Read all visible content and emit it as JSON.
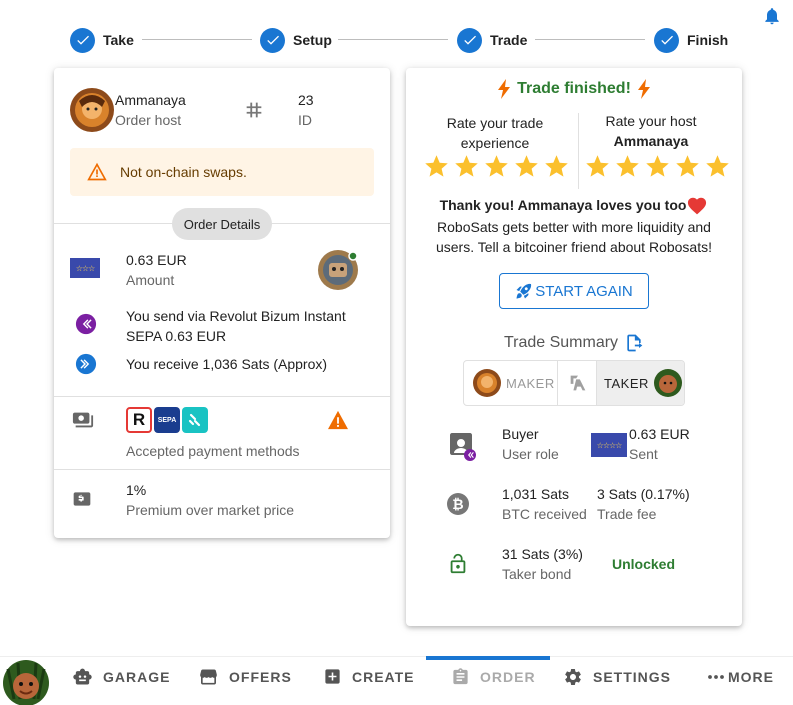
{
  "stepper": {
    "steps": [
      {
        "label": "Take"
      },
      {
        "label": "Setup"
      },
      {
        "label": "Trade"
      },
      {
        "label": "Finish"
      }
    ]
  },
  "order_card": {
    "host_name": "Ammanaya",
    "host_role": "Order host",
    "order_id": "23",
    "order_id_label": "ID",
    "warning": "Not on-chain swaps.",
    "details_chip": "Order Details",
    "amount": "0.63 EUR",
    "amount_label": "Amount",
    "send_text": "You send via Revolut Bizum Instant SEPA 0.63 EUR",
    "receive_text": "You receive 1,036 Sats (Approx)",
    "payment_methods_label": "Accepted payment methods",
    "premium": "1%",
    "premium_label": "Premium over market price"
  },
  "trade_card": {
    "title": "Trade finished!",
    "rate_trade_label": "Rate your trade experience",
    "rate_host_label": "Rate your host",
    "rate_host_name": "Ammanaya",
    "thanks": "Thank you! Ammanaya loves you too",
    "share_text": "RoboSats gets better with more liquidity and users. Tell a bitcoiner friend about Robosats!",
    "start_again": "START AGAIN",
    "summary_title": "Trade Summary",
    "toggle_maker": "MAKER",
    "toggle_taker": "TAKER",
    "user_role_value": "Buyer",
    "user_role_label": "User role",
    "sent_value": "0.63 EUR",
    "sent_label": "Sent",
    "btc_value": "1,031 Sats",
    "btc_label": "BTC received",
    "fee_value": "3 Sats (0.17%)",
    "fee_label": "Trade fee",
    "bond_value": "31 Sats (3%)",
    "bond_label": "Taker bond",
    "bond_status": "Unlocked"
  },
  "nav": {
    "garage": "GARAGE",
    "offers": "OFFERS",
    "create": "CREATE",
    "order": "ORDER",
    "settings": "SETTINGS",
    "more": "MORE"
  },
  "colors": {
    "primary": "#1976d2",
    "success": "#2e7d32",
    "warning": "#ef6c00",
    "star": "#fbc02d",
    "accent_purple": "#7b1fa2"
  }
}
